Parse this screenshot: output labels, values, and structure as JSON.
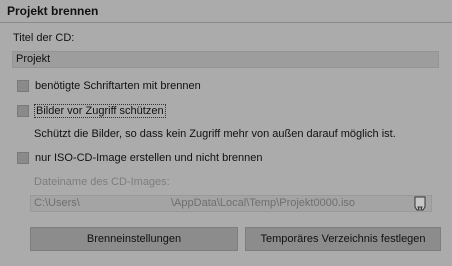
{
  "section": {
    "title": "Projekt brennen"
  },
  "cd_title": {
    "label": "Titel der CD:",
    "value": "Projekt"
  },
  "options": [
    {
      "label": "benötigte Schriftarten mit brennen",
      "checked": false
    },
    {
      "label": "Bilder vor Zugriff schützen",
      "checked": false
    },
    {
      "label": "nur ISO-CD-Image erstellen und nicht brennen",
      "checked": false
    }
  ],
  "protect_description": "Schützt die Bilder, so dass kein Zugriff mehr von außen darauf möglich ist.",
  "iso": {
    "label": "Dateiname des CD-Images:",
    "path_start": "C:\\Users\\",
    "path_end": "\\AppData\\Local\\Temp\\Projekt0000.iso",
    "browse_icon": "file-browse-icon"
  },
  "buttons": {
    "burn_settings": "Brenneinstellungen",
    "temp_dir": "Temporäres Verzeichnis festlegen"
  }
}
